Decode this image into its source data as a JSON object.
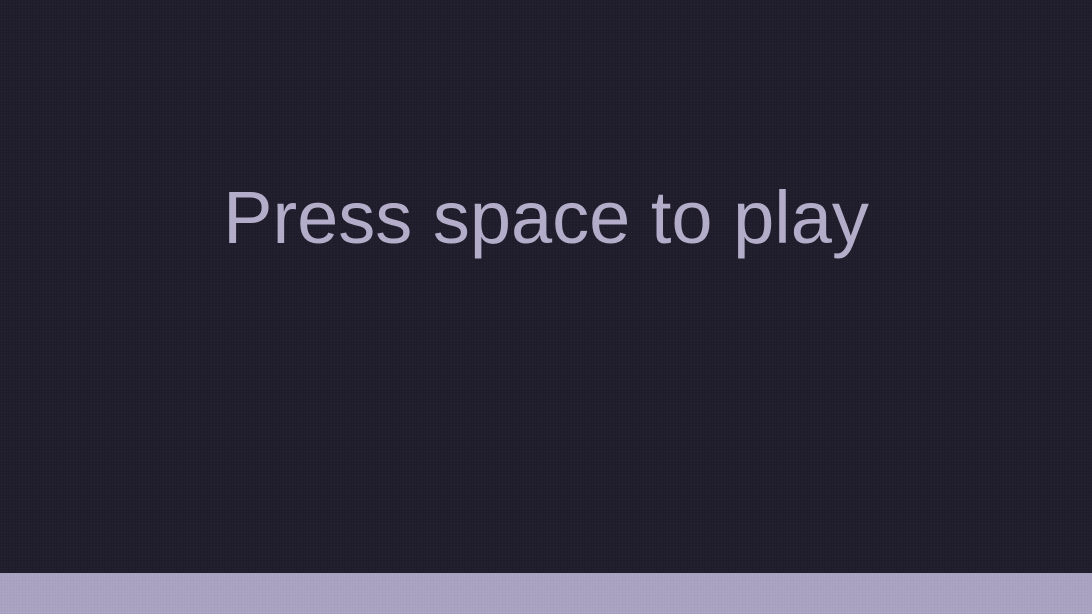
{
  "game": {
    "prompt_text": "Press space to play",
    "background_color": "#201e2c",
    "text_color": "#b3adc9",
    "ground_color": "#aaa4c2"
  }
}
